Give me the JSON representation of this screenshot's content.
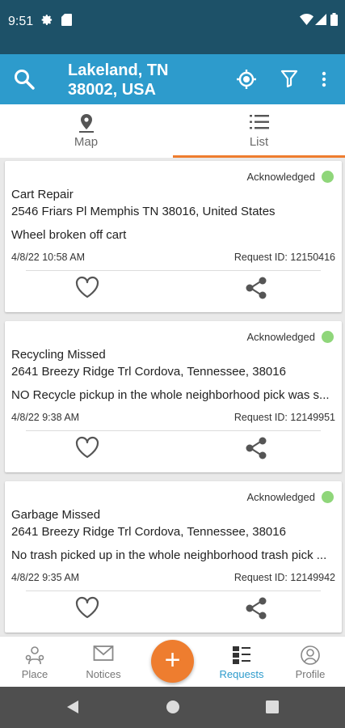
{
  "status_bar": {
    "time": "9:51",
    "icons": [
      "settings-icon",
      "sd-card-icon",
      "wifi-icon",
      "signal-icon",
      "battery-icon"
    ]
  },
  "app_bar": {
    "title_line1": "Lakeland, TN",
    "title_line2": "38002, USA",
    "icons": [
      "search-icon",
      "my-location-icon",
      "filter-icon",
      "more-vert-icon"
    ]
  },
  "tabs": [
    {
      "label": "Map",
      "icon": "map-pin-icon",
      "active": false
    },
    {
      "label": "List",
      "icon": "list-icon",
      "active": true
    }
  ],
  "requests": [
    {
      "status": "Acknowledged",
      "category": "Cart Repair",
      "address": "2546 Friars Pl Memphis TN 38016, United States",
      "description": "Wheel broken off cart",
      "date": "4/8/22 10:58 AM",
      "request_id": "Request ID: 12150416"
    },
    {
      "status": "Acknowledged",
      "category": "Recycling Missed",
      "address": "2641 Breezy Ridge Trl Cordova, Tennessee, 38016",
      "description": "NO Recycle pickup in the whole neighborhood pick was s...",
      "date": "4/8/22 9:38 AM",
      "request_id": "Request ID: 12149951"
    },
    {
      "status": "Acknowledged",
      "category": "Garbage Missed",
      "address": "2641 Breezy Ridge Trl Cordova, Tennessee, 38016",
      "description": "No trash picked up in the whole neighborhood trash pick ...",
      "date": "4/8/22 9:35 AM",
      "request_id": "Request ID: 12149942"
    }
  ],
  "bottom_nav": [
    {
      "label": "Place",
      "icon": "place-icon",
      "active": false
    },
    {
      "label": "Notices",
      "icon": "mail-icon",
      "active": false
    },
    {
      "label": "Requests",
      "icon": "requests-icon",
      "active": true
    },
    {
      "label": "Profile",
      "icon": "profile-icon",
      "active": false
    }
  ],
  "fab": {
    "label": "+"
  },
  "colors": {
    "status_bar": "#1d5168",
    "app_bar": "#2d9bcc",
    "accent": "#ee7d2f",
    "status_dot": "#8fd67a",
    "active_nav": "#2d9bcc"
  }
}
